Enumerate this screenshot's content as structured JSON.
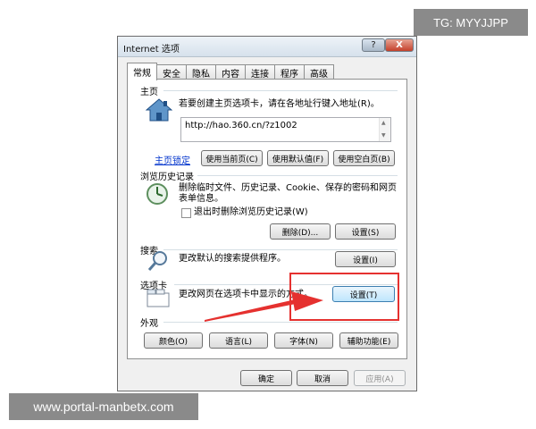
{
  "watermarks": {
    "top": "TG: MYYJJPP",
    "bottom": "www.portal-manbetx.com"
  },
  "dialog": {
    "title": "Internet 选项",
    "help_glyph": "?",
    "close_glyph": "X"
  },
  "tabs": [
    "常规",
    "安全",
    "隐私",
    "内容",
    "连接",
    "程序",
    "高级"
  ],
  "homepage": {
    "label": "主页",
    "description": "若要创建主页选项卡，请在各地址行键入地址(R)。",
    "url": "http://hao.360.cn/?z1002",
    "scroll_up": "▲",
    "scroll_down": "▼",
    "link": "主页锁定",
    "btn_current": "使用当前页(C)",
    "btn_default": "使用默认值(F)",
    "btn_blank": "使用空白页(B)"
  },
  "history": {
    "label": "浏览历史记录",
    "description": "删除临时文件、历史记录、Cookie、保存的密码和网页表单信息。",
    "checkbox_label": "退出时删除浏览历史记录(W)",
    "btn_delete": "删除(D)...",
    "btn_settings": "设置(S)"
  },
  "search": {
    "label": "搜索",
    "description": "更改默认的搜索提供程序。",
    "btn_settings": "设置(I)"
  },
  "tabsection": {
    "label": "选项卡",
    "description": "更改网页在选项卡中显示的方式。",
    "btn_settings": "设置(T)"
  },
  "appearance": {
    "label": "外观",
    "btn_colors": "颜色(O)",
    "btn_languages": "语言(L)",
    "btn_fonts": "字体(N)",
    "btn_accessibility": "辅助功能(E)"
  },
  "footer": {
    "ok": "确定",
    "cancel": "取消",
    "apply": "应用(A)"
  },
  "colors": {
    "highlight": "#e5312f",
    "link": "#0033cc"
  }
}
